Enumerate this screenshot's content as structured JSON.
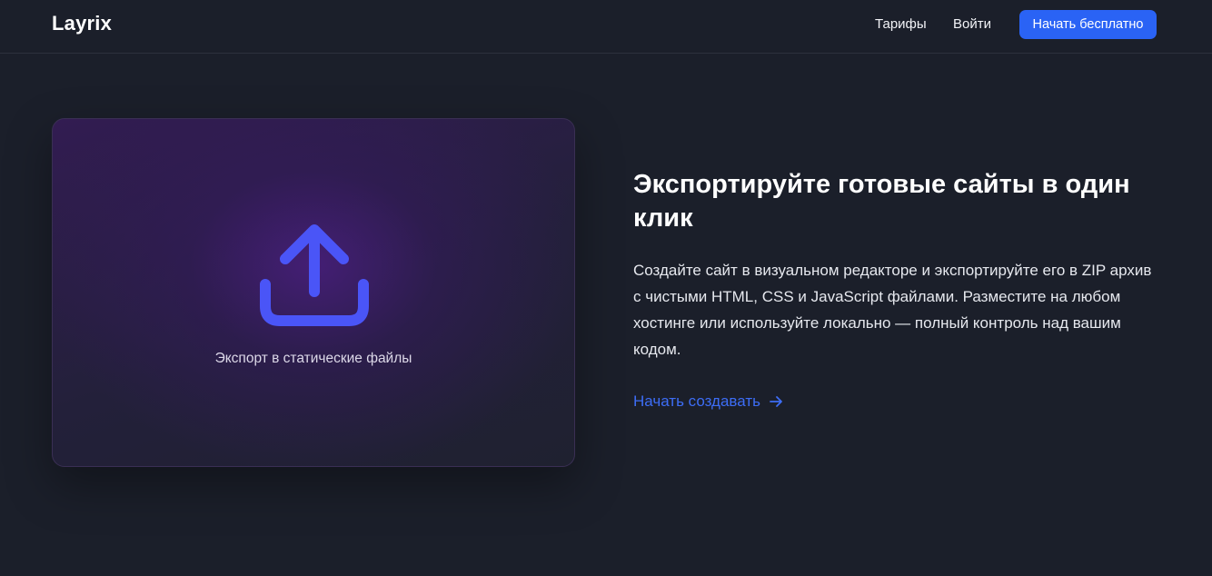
{
  "header": {
    "logo": "Layrix",
    "nav": {
      "pricing": "Тарифы",
      "login": "Войти"
    },
    "cta": "Начать бесплатно"
  },
  "feature": {
    "card_caption": "Экспорт в статические файлы",
    "card_icon": "upload-icon",
    "title": "Экспортируйте готовые сайты в один клик",
    "description": "Создайте сайт в визуальном редакторе и экспортируйте его в ZIP архив с чистыми HTML, CSS и JavaScript файлами. Разместите на любом хостинге или используйте локально — полный контроль над вашим кодом.",
    "link": "Начать создавать",
    "link_icon": "arrow-right-icon"
  },
  "colors": {
    "background": "#1b1f2a",
    "accent": "#2a63f5",
    "icon": "#4a55f7",
    "link": "#3d6df5"
  }
}
